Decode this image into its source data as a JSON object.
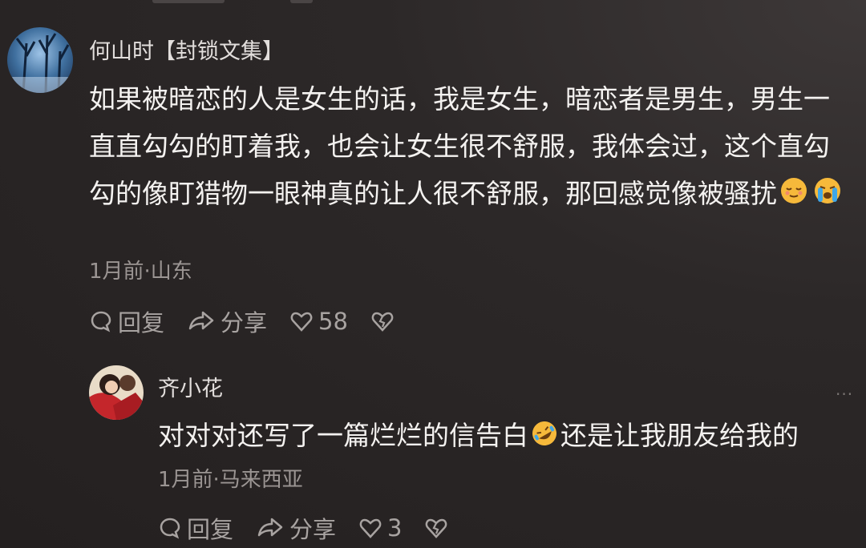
{
  "comments": [
    {
      "username": "何山时【封锁文集】",
      "text": "如果被暗恋的人是女生的话，我是女生，暗恋者是男生，男生一直直勾勾的盯着我，也会让女生很不舒服，我体会过，这个直勾勾的像盯猎物一眼神真的让人很不舒服，那回感觉像被骚扰",
      "emojis": [
        "relieved-face-emoji",
        "loudly-crying-face-emoji"
      ],
      "meta": "1月前·山东",
      "actions": {
        "reply": "回复",
        "share": "分享",
        "likes": "58"
      }
    },
    {
      "username": "齐小花",
      "text": "对对对还写了一篇烂烂的信告白",
      "text_after": "还是让我朋友给我的",
      "emojis": [
        "rolling-on-floor-laughing-emoji"
      ],
      "meta": "1月前·马来西亚",
      "actions": {
        "reply": "回复",
        "share": "分享",
        "likes": "3"
      },
      "more_label": "···"
    }
  ],
  "colors": {
    "background": "#2a2626",
    "text": "#f4f2f0",
    "secondary": "#9b9593"
  }
}
